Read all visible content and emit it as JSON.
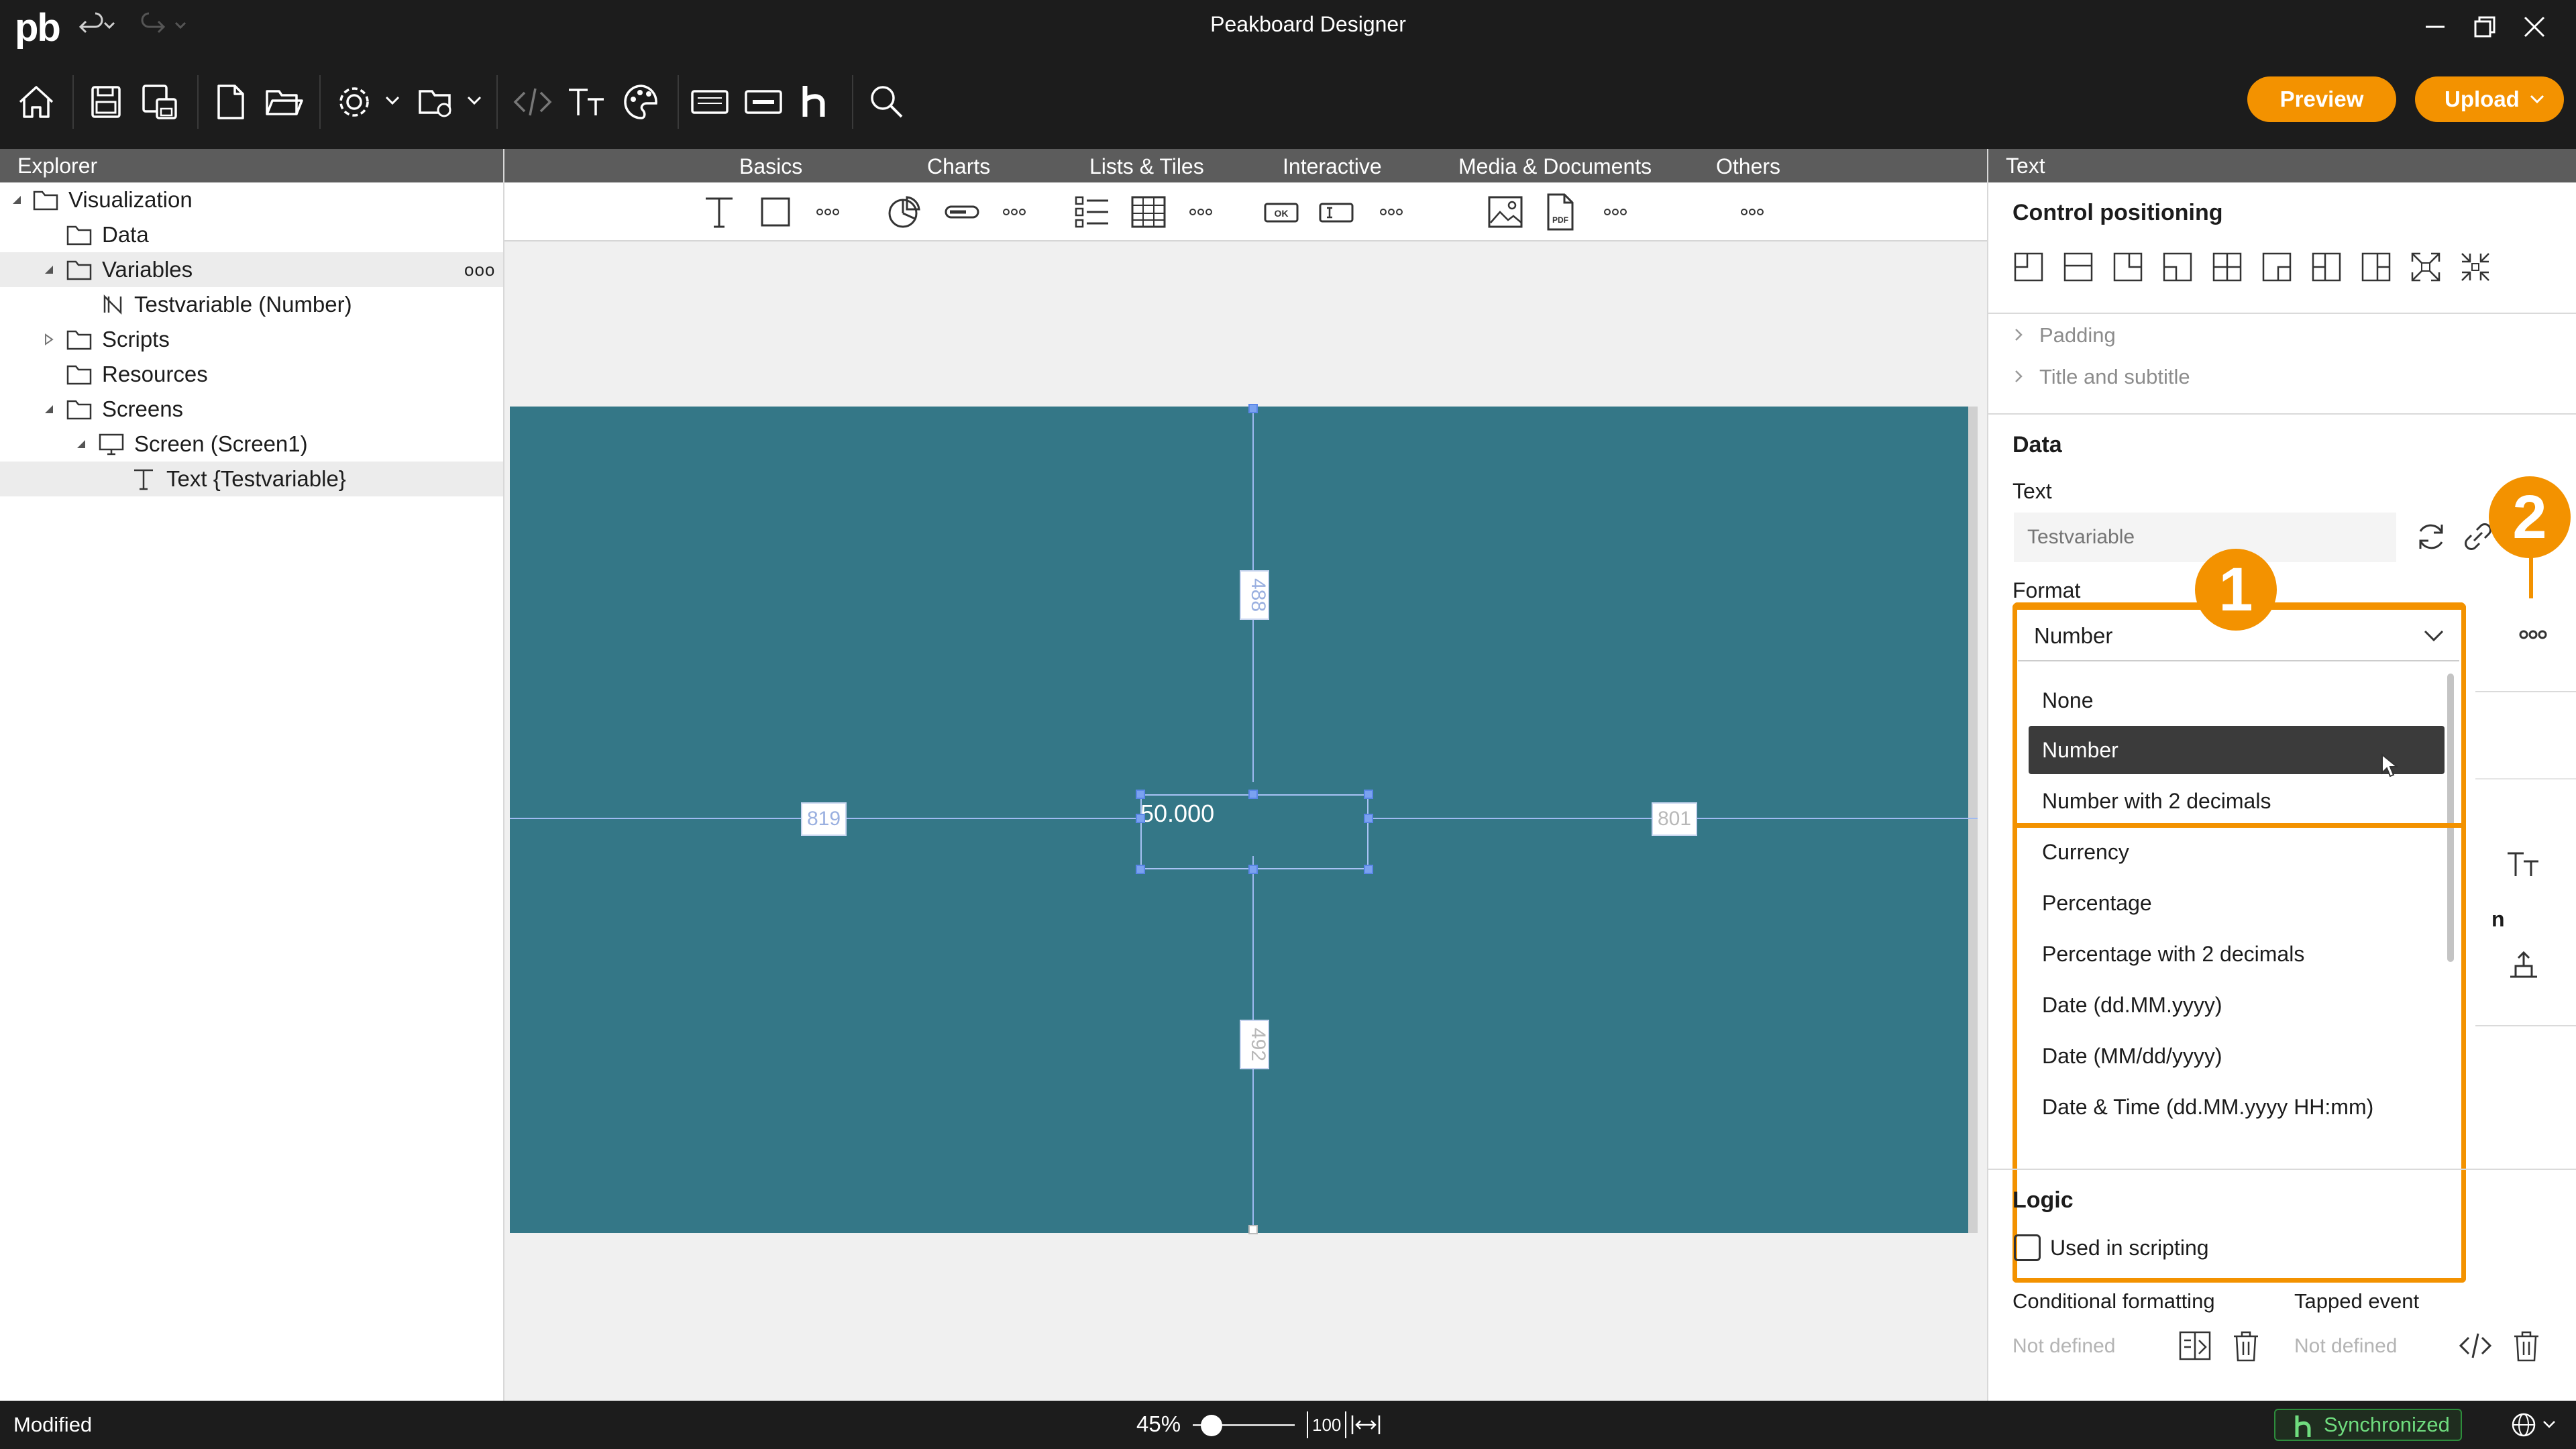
{
  "app": {
    "logo": "pb",
    "title": "Peakboard Designer"
  },
  "toolbar": {
    "preview_label": "Preview",
    "upload_label": "Upload"
  },
  "explorer": {
    "header": "Explorer",
    "tree": [
      {
        "label": "Visualization",
        "icon": "folder-icon",
        "expanded": true
      },
      {
        "label": "Data",
        "icon": "folder-icon"
      },
      {
        "label": "Variables",
        "icon": "folder-icon",
        "expanded": true,
        "more": "ooo"
      },
      {
        "label": "Testvariable (Number)",
        "icon": "number-variable-icon"
      },
      {
        "label": "Scripts",
        "icon": "folder-icon",
        "expanded": false
      },
      {
        "label": "Resources",
        "icon": "folder-icon"
      },
      {
        "label": "Screens",
        "icon": "folder-icon",
        "expanded": true
      },
      {
        "label": "Screen (Screen1)",
        "icon": "monitor-icon",
        "expanded": true
      },
      {
        "label": "Text {Testvariable}",
        "icon": "text-icon"
      }
    ]
  },
  "categories": [
    "Basics",
    "Charts",
    "Lists & Tiles",
    "Interactive",
    "Media & Documents",
    "Others"
  ],
  "canvas": {
    "text_value": "50.000",
    "measure_top": "488",
    "measure_left": "819",
    "measure_right": "801",
    "measure_bottom": "492",
    "screen_color": "#347787"
  },
  "properties": {
    "header": "Text",
    "control_positioning": "Control positioning",
    "padding": "Padding",
    "title_subtitle": "Title and subtitle",
    "data_title": "Data",
    "text_label": "Text",
    "text_placeholder": "Testvariable",
    "format_label": "Format",
    "format_selected": "Number",
    "format_options": [
      "None",
      "Number",
      "Number with 2 decimals",
      "Currency",
      "Percentage",
      "Percentage with 2 decimals",
      "Date (dd.MM.yyyy)",
      "Date (MM/dd/yyyy)",
      "Date & Time (dd.MM.yyyy HH:mm)"
    ],
    "hidden_partial_letter": "n",
    "logic_title": "Logic",
    "used_in_scripting": "Used in scripting",
    "conditional_formatting": "Conditional formatting",
    "tapped_event": "Tapped event",
    "not_defined_1": "Not defined",
    "not_defined_2": "Not defined",
    "callout_1": "1",
    "callout_2": "2"
  },
  "status": {
    "modified": "Modified",
    "zoom": "45%",
    "zoom_level": 0.1,
    "zoom_100": "100",
    "sync": "Synchronized"
  },
  "colors": {
    "accent": "#f39200",
    "dark": "#1c1c1c",
    "sync_green": "#6fdc7e"
  }
}
